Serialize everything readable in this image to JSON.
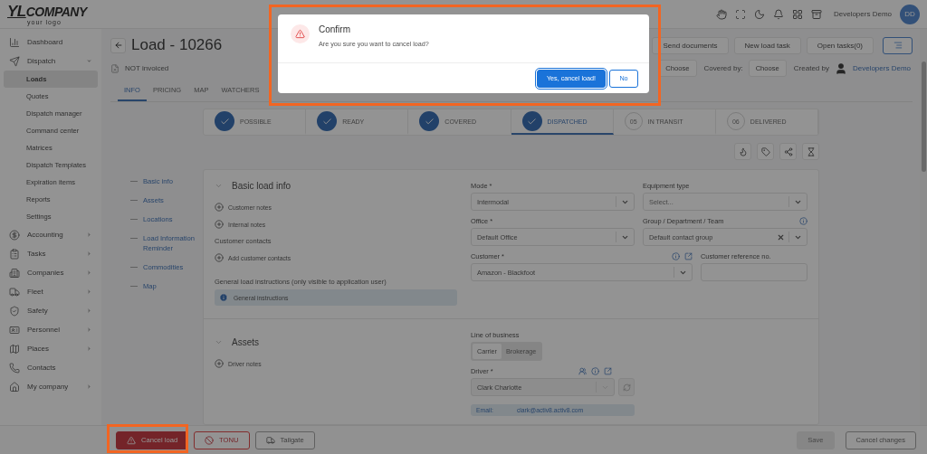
{
  "logo": {
    "mark": "YL",
    "name": "COMPANY",
    "tagline": "your logo"
  },
  "user": {
    "name": "Developers Demo",
    "initials": "DD"
  },
  "sidebar": {
    "items": [
      {
        "label": "Dashboard",
        "kind": "link"
      },
      {
        "label": "Dispatch",
        "kind": "group",
        "expanded": true,
        "children": [
          {
            "label": "Loads",
            "selected": true
          },
          {
            "label": "Quotes",
            "selected": false
          },
          {
            "label": "Dispatch manager",
            "selected": false
          },
          {
            "label": "Command center",
            "selected": false
          },
          {
            "label": "Matrices",
            "selected": false
          },
          {
            "label": "Dispatch Templates",
            "selected": false
          },
          {
            "label": "Expiration items",
            "selected": false
          },
          {
            "label": "Reports",
            "selected": false
          },
          {
            "label": "Settings",
            "selected": false
          }
        ]
      },
      {
        "label": "Accounting",
        "kind": "group",
        "expanded": false
      },
      {
        "label": "Tasks",
        "kind": "group",
        "expanded": false
      },
      {
        "label": "Companies",
        "kind": "group",
        "expanded": false
      },
      {
        "label": "Fleet",
        "kind": "group",
        "expanded": false
      },
      {
        "label": "Safety",
        "kind": "group",
        "expanded": false
      },
      {
        "label": "Personnel",
        "kind": "group",
        "expanded": false
      },
      {
        "label": "Places",
        "kind": "group",
        "expanded": false
      },
      {
        "label": "Contacts",
        "kind": "link"
      },
      {
        "label": "My company",
        "kind": "group",
        "expanded": false
      }
    ]
  },
  "header": {
    "title": "Load - 10266",
    "actions": [
      "Send documents",
      "New load task",
      "Open tasks(0)"
    ],
    "invoice_status": "NOT invoiced",
    "assignments": [
      {
        "button": "Choose"
      },
      {
        "label": "Covered by:",
        "button": "Choose"
      }
    ],
    "created_by_label": "Created by",
    "created_by": "Developers Demo"
  },
  "tabs": [
    {
      "label": "INFO",
      "selected": true
    },
    {
      "label": "PRICING",
      "selected": false
    },
    {
      "label": "MAP",
      "selected": false
    },
    {
      "label": "WATCHERS",
      "selected": false
    }
  ],
  "steps": [
    {
      "label": "POSSIBLE",
      "done": true,
      "selected": false
    },
    {
      "label": "READY",
      "done": true,
      "selected": false
    },
    {
      "label": "COVERED",
      "done": true,
      "selected": false
    },
    {
      "label": "DISPATCHED",
      "done": true,
      "selected": true
    },
    {
      "number": "05",
      "label": "IN TRANSIT",
      "done": false,
      "selected": false
    },
    {
      "number": "06",
      "label": "DELIVERED",
      "done": false,
      "selected": false
    }
  ],
  "section_nav": [
    "Basic info",
    "Assets",
    "Locations",
    "Load Information Reminder",
    "Commodities",
    "Map"
  ],
  "basic_info": {
    "title": "Basic load info",
    "add_links": [
      "Customer notes",
      "Internal notes"
    ],
    "contacts_label": "Customer contacts",
    "contacts_add": "Add customer contacts",
    "instructions_label": "General load instructions (only visible to application user)",
    "instructions": "General instructions",
    "mode": {
      "label": "Mode *",
      "value": "Intermodal"
    },
    "equipment": {
      "label": "Equipment type",
      "placeholder": "Select..."
    },
    "office": {
      "label": "Office *",
      "value": "Default Office"
    },
    "group": {
      "label": "Group / Department / Team",
      "value": "Default contact group"
    },
    "customer": {
      "label": "Customer *",
      "value": "Amazon - Blackfoot"
    },
    "reference": {
      "label": "Customer reference no."
    }
  },
  "assets": {
    "title": "Assets",
    "add_links": [
      "Driver notes"
    ],
    "line_of_business": {
      "label": "Line of business",
      "options": [
        {
          "label": "Carrier",
          "selected": true
        },
        {
          "label": "Brokerage",
          "selected": false
        }
      ]
    },
    "driver": {
      "label": "Driver *",
      "value": "Clark Charlotte",
      "email_label": "Email:",
      "email": "clark@activ8.activ8.com"
    }
  },
  "footer": {
    "left": [
      {
        "label": "Cancel load",
        "kind": "danger"
      },
      {
        "label": "TONU",
        "kind": "outline-danger"
      },
      {
        "label": "Tailgate",
        "kind": "outline"
      }
    ],
    "right": [
      {
        "label": "Save",
        "kind": "disabled"
      },
      {
        "label": "Cancel changes",
        "kind": "outline"
      }
    ]
  },
  "dialog": {
    "title": "Confirm",
    "message": "Are you sure you want to cancel load?",
    "confirm": "Yes, cancel load!",
    "cancel": "No"
  }
}
